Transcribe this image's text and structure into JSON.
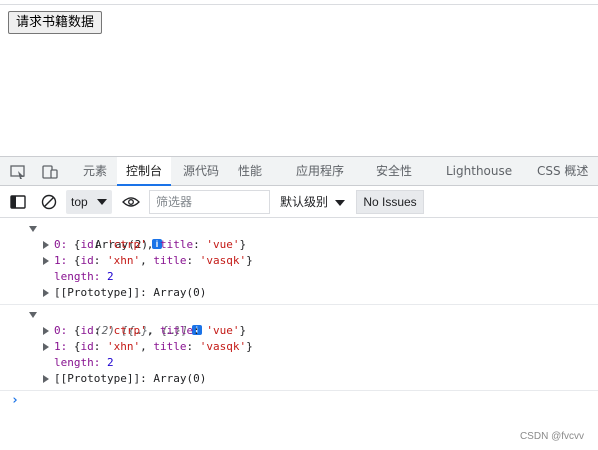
{
  "page": {
    "button_label": "请求书籍数据"
  },
  "devtools": {
    "tabs": [
      {
        "label": "元素"
      },
      {
        "label": "控制台"
      },
      {
        "label": "源代码"
      },
      {
        "label": "性能"
      },
      {
        "label": "应用程序"
      },
      {
        "label": "安全性"
      },
      {
        "label": "Lighthouse"
      },
      {
        "label": "CSS 概述"
      }
    ],
    "toolbar": {
      "context": "top",
      "filter_placeholder": "筛选器",
      "levels_label": "默认级别",
      "issues_label": "No Issues"
    }
  },
  "console": {
    "entry1": {
      "header": "Array(2)",
      "items": [
        {
          "key": "0",
          "id": "'ctrp'",
          "title": "'vue'"
        },
        {
          "key": "1",
          "id": "'xhn'",
          "title": "'vasqk'"
        }
      ],
      "length_key": "length",
      "length_value": "2",
      "proto_key": "[[Prototype]]",
      "proto_value": "Array(0)"
    },
    "entry2": {
      "header": "(2) [{…}, {…}]",
      "items": [
        {
          "key": "0",
          "id": "'ctrp'",
          "title": "'vue'"
        },
        {
          "key": "1",
          "id": "'xhn'",
          "title": "'vasqk'"
        }
      ],
      "length_key": "length",
      "length_value": "2",
      "proto_key": "[[Prototype]]",
      "proto_value": "Array(0)"
    },
    "prompt_symbol": "›"
  },
  "watermark": "CSDN @fvcvv",
  "colors": {
    "accent": "#1a73e8",
    "key": "#881391",
    "string": "#c41a16",
    "number": "#1c00cf"
  }
}
